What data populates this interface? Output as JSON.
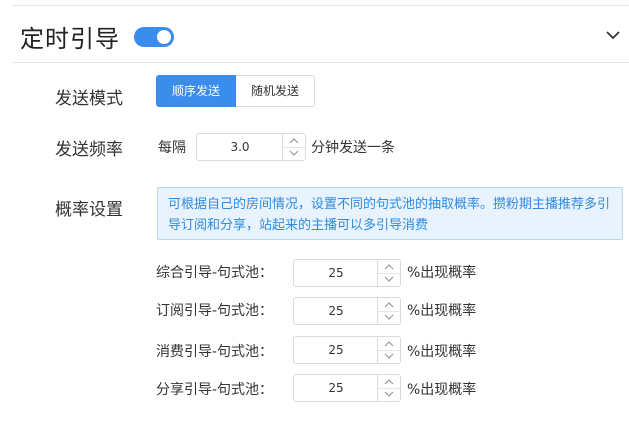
{
  "header": {
    "title": "定时引导",
    "toggle_on": true
  },
  "send_mode": {
    "label": "发送模式",
    "options": [
      "顺序发送",
      "随机发送"
    ],
    "selected": "顺序发送"
  },
  "frequency": {
    "label": "发送频率",
    "prefix": "每隔",
    "value": "3.0",
    "suffix": "分钟发送一条"
  },
  "probability": {
    "label": "概率设置",
    "info": "可根据自己的房间情况，设置不同的句式池的抽取概率。攒粉期主播推荐多引导订阅和分享，站起来的主播可以多引导消费",
    "unit": "%出现概率",
    "items": [
      {
        "label": "综合引导-句式池：",
        "value": "25"
      },
      {
        "label": "订阅引导-句式池：",
        "value": "25"
      },
      {
        "label": "消费引导-句式池：",
        "value": "25"
      },
      {
        "label": "分享引导-句式池：",
        "value": "25"
      }
    ]
  },
  "colors": {
    "accent": "#3b8ded",
    "info_bg": "#e8f3fd",
    "info_text": "#2f8be0"
  }
}
